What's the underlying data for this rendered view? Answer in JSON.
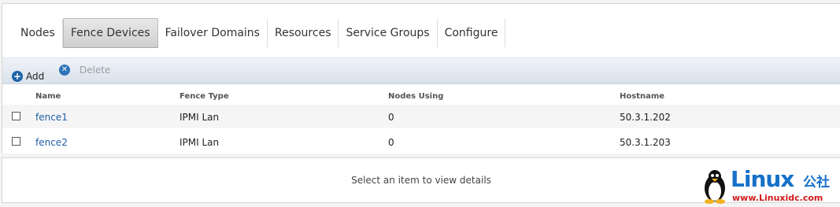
{
  "tabs": [
    {
      "label": "Nodes",
      "active": false
    },
    {
      "label": "Fence Devices",
      "active": true
    },
    {
      "label": "Failover Domains",
      "active": false
    },
    {
      "label": "Resources",
      "active": false
    },
    {
      "label": "Service Groups",
      "active": false
    },
    {
      "label": "Configure",
      "active": false
    }
  ],
  "toolbar": {
    "add_label": "Add",
    "delete_label": "Delete"
  },
  "table": {
    "headers": [
      "Name",
      "Fence Type",
      "Nodes Using",
      "Hostname"
    ],
    "rows": [
      {
        "name": "fence1",
        "type": "IPMI Lan",
        "nodes": "0",
        "host": "50.3.1.202"
      },
      {
        "name": "fence2",
        "type": "IPMI Lan",
        "nodes": "0",
        "host": "50.3.1.203"
      }
    ]
  },
  "details": {
    "message": "Select an item to view details"
  },
  "watermark": {
    "brand": "Linux",
    "brand_cn": "公社",
    "site": "www.Linuxidc.com"
  },
  "colors": {
    "link": "#1f5fa8",
    "accent": "#1c64a8",
    "watermark_blue": "#1670c9",
    "watermark_red": "#d01a1a"
  }
}
